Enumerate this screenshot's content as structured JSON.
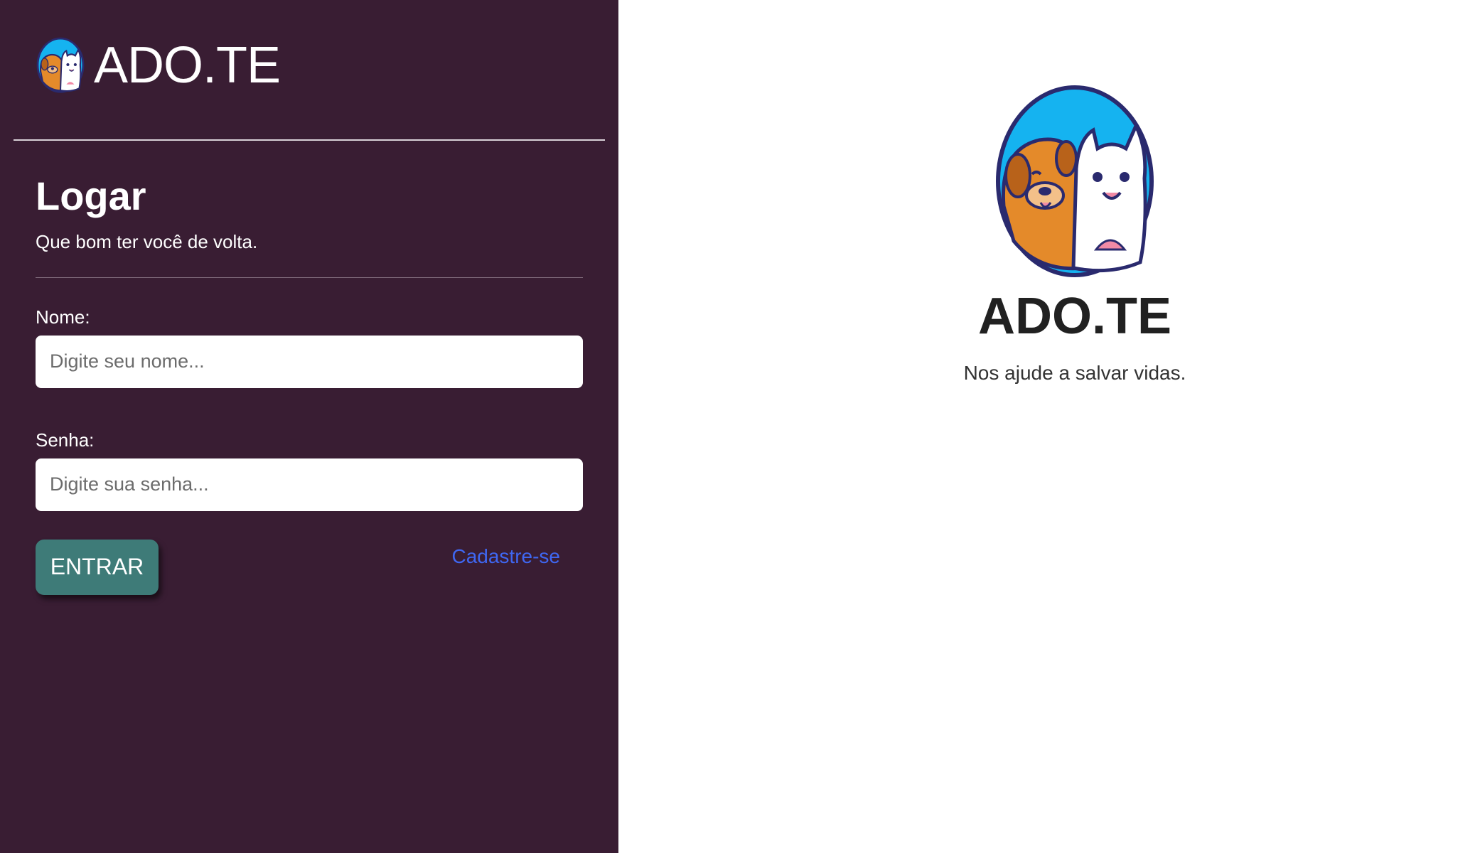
{
  "brand": {
    "logo_icon": "dog-and-cat-logo-icon",
    "title": "ADO.TE"
  },
  "login": {
    "heading": "Logar",
    "subtitle": "Que bom ter você de volta.",
    "name_label": "Nome:",
    "name_placeholder": "Digite seu nome...",
    "password_label": "Senha:",
    "password_placeholder": "Digite sua senha...",
    "submit_label": "ENTRAR",
    "signup_label": "Cadastre-se"
  },
  "hero": {
    "logo_icon": "dog-and-cat-logo-icon",
    "title": "ADO.TE",
    "tagline": "Nos ajude a salvar vidas."
  },
  "colors": {
    "sidebar_bg": "#391d33",
    "button_bg": "#3e7b78",
    "link": "#3f67f2",
    "logo_circle": "#15b3f0"
  }
}
